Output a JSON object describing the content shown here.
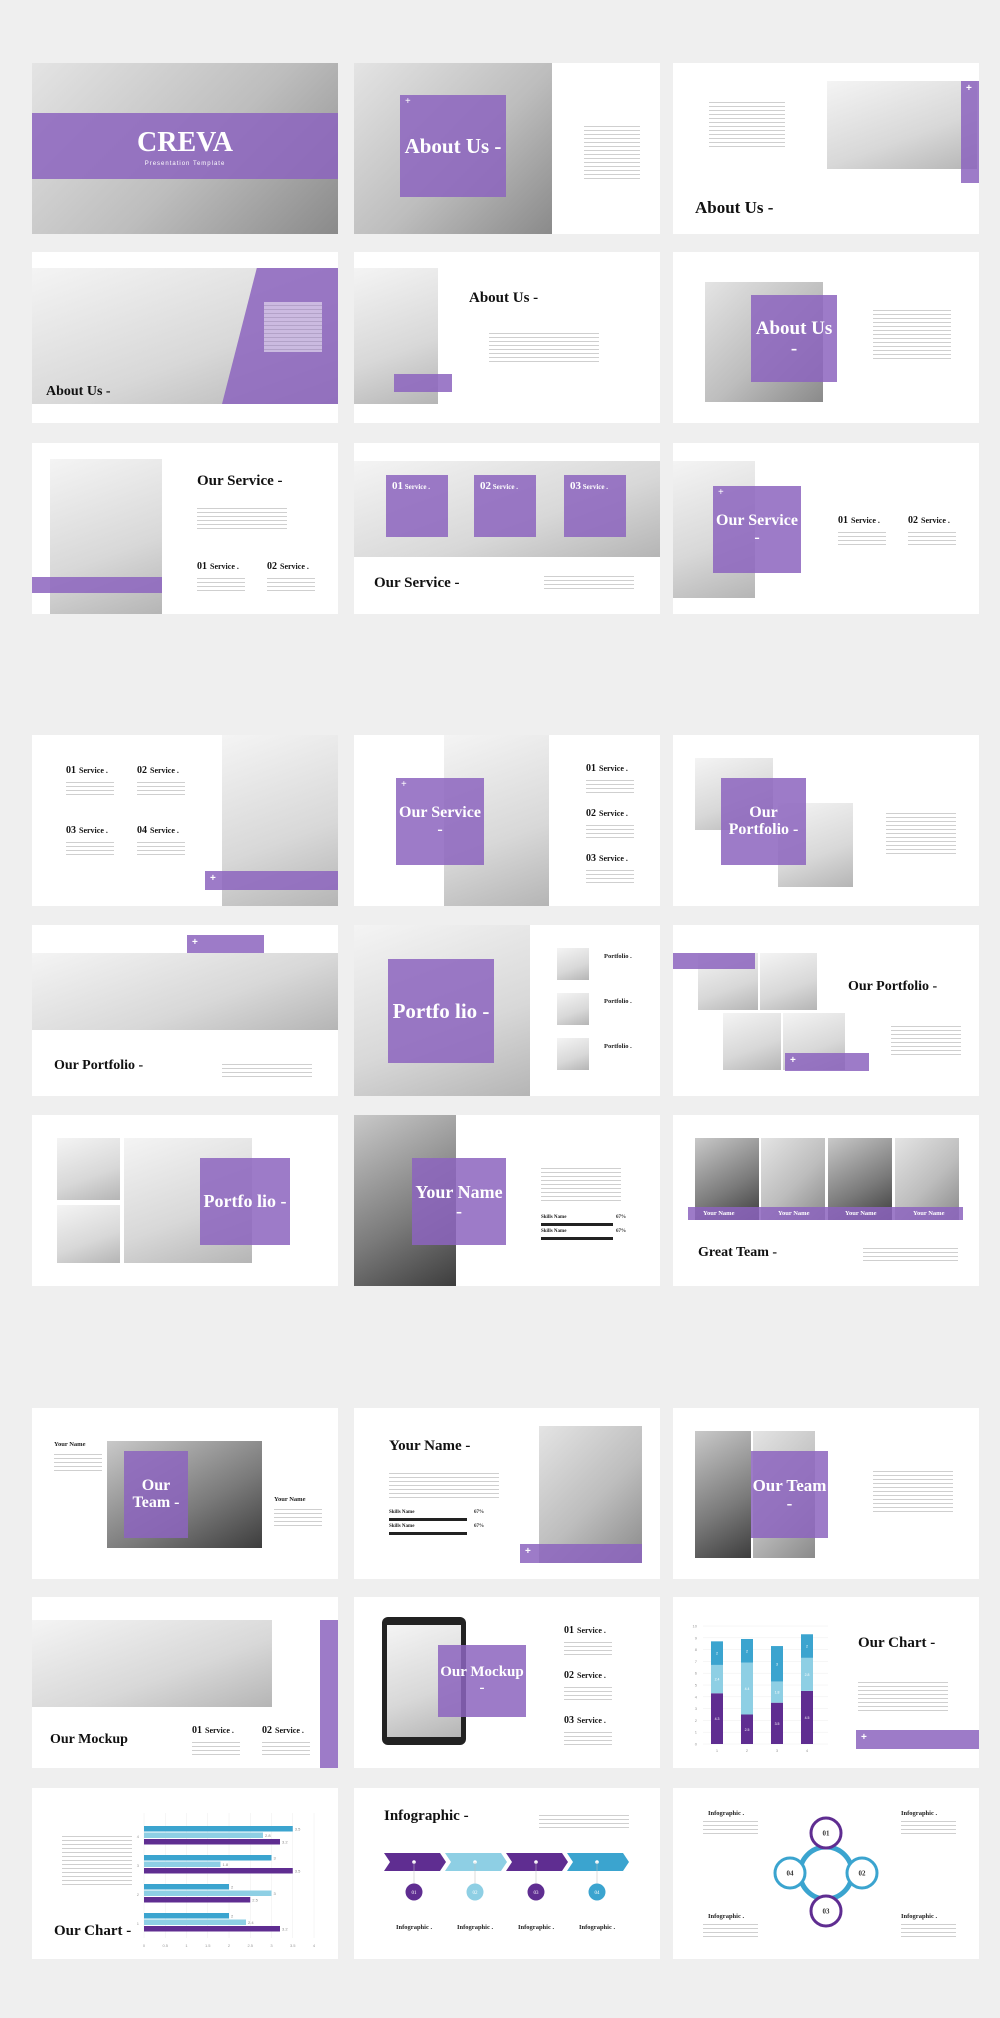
{
  "colors": {
    "background": "#efefef",
    "purple": "#8c64be",
    "dark_purple": "#5f2d91",
    "light_blue": "#8ecfe4",
    "blue": "#3ba4cf"
  },
  "slides": [
    {
      "title": "CREVA",
      "subtitle": "Presentation Template"
    },
    {
      "title": "About Us -"
    },
    {
      "title": "About Us -"
    },
    {
      "title": "About Us -"
    },
    {
      "title": "About Us -"
    },
    {
      "title": "About Us -"
    },
    {
      "title": "Our Service -",
      "items": [
        {
          "num": "01",
          "label": "Service ."
        },
        {
          "num": "02",
          "label": "Service ."
        }
      ]
    },
    {
      "title": "Our Service -",
      "items": [
        {
          "num": "01",
          "label": "Service ."
        },
        {
          "num": "02",
          "label": "Service ."
        },
        {
          "num": "03",
          "label": "Service ."
        }
      ]
    },
    {
      "title": "Our Service -",
      "items": [
        {
          "num": "01",
          "label": "Service ."
        },
        {
          "num": "02",
          "label": "Service ."
        }
      ]
    },
    {
      "items": [
        {
          "num": "01",
          "label": "Service ."
        },
        {
          "num": "02",
          "label": "Service ."
        },
        {
          "num": "03",
          "label": "Service ."
        },
        {
          "num": "04",
          "label": "Service ."
        }
      ]
    },
    {
      "title": "Our Service -",
      "items": [
        {
          "num": "01",
          "label": "Service ."
        },
        {
          "num": "02",
          "label": "Service ."
        },
        {
          "num": "03",
          "label": "Service ."
        }
      ]
    },
    {
      "title": "Our Portfolio -"
    },
    {
      "title": "Our Portfolio -"
    },
    {
      "title": "Portfo lio -",
      "items": [
        {
          "label": "Portfolio ."
        },
        {
          "label": "Portfolio ."
        },
        {
          "label": "Portfolio ."
        }
      ]
    },
    {
      "title": "Our Portfolio -"
    },
    {
      "title": "Portfo lio -"
    },
    {
      "title": "Your Name -",
      "skills": [
        {
          "label": "Skills Name",
          "value": "67%"
        },
        {
          "label": "Skills Name",
          "value": "67%"
        }
      ]
    },
    {
      "title": "Great Team -",
      "names": [
        "Your Name",
        "Your Name",
        "Your Name",
        "Your Name"
      ]
    },
    {
      "title": "Our Team -",
      "names": [
        "Your Name",
        "Your Name"
      ]
    },
    {
      "title": "Your Name -",
      "skills": [
        {
          "label": "Skills Name",
          "value": "67%"
        },
        {
          "label": "Skills Name",
          "value": "67%"
        }
      ]
    },
    {
      "title": "Our Team -"
    },
    {
      "title": "Our Mockup",
      "items": [
        {
          "num": "01",
          "label": "Service ."
        },
        {
          "num": "02",
          "label": "Service ."
        }
      ]
    },
    {
      "title": "Our Mockup -",
      "items": [
        {
          "num": "01",
          "label": "Service ."
        },
        {
          "num": "02",
          "label": "Service ."
        },
        {
          "num": "03",
          "label": "Service ."
        }
      ]
    },
    {
      "title": "Our Chart -"
    },
    {
      "title": "Our Chart -"
    },
    {
      "title": "Infographic -",
      "steps": [
        "01",
        "02",
        "03",
        "04"
      ],
      "labels": [
        "Infographic .",
        "Infographic .",
        "Infographic .",
        "Infographic ."
      ]
    },
    {
      "steps": [
        "01",
        "02",
        "03",
        "04"
      ],
      "labels": [
        "Infographic .",
        "Infographic .",
        "Infographic .",
        "Infographic ."
      ]
    }
  ],
  "chart_data": [
    {
      "type": "bar",
      "stacked": true,
      "categories": [
        "1",
        "2",
        "3",
        "4"
      ],
      "ylim": [
        0,
        10
      ],
      "yticks": [
        "0",
        "1",
        "2",
        "3",
        "4",
        "5",
        "6",
        "7",
        "8",
        "9",
        "10"
      ],
      "series": [
        {
          "color": "#5f2d91",
          "values": [
            4.3,
            2.5,
            3.5,
            4.5
          ]
        },
        {
          "color": "#8ecfe4",
          "values": [
            2.4,
            4.4,
            1.8,
            2.8
          ]
        },
        {
          "color": "#3ba4cf",
          "values": [
            2,
            2,
            3,
            2
          ]
        }
      ]
    },
    {
      "type": "bar",
      "orientation": "horizontal",
      "categories": [
        "1",
        "2",
        "3",
        "4"
      ],
      "xlim": [
        0,
        4
      ],
      "xticks": [
        "0",
        "0.5",
        "1",
        "1.5",
        "2",
        "2.5",
        "3",
        "3.5",
        "4"
      ],
      "series": [
        {
          "color": "#3ba4cf",
          "values": [
            2,
            2,
            3,
            3.5
          ]
        },
        {
          "color": "#8ecfe4",
          "values": [
            2.4,
            3,
            1.8,
            2.8
          ]
        },
        {
          "color": "#5f2d91",
          "values": [
            3.2,
            2.5,
            3.5,
            3.2
          ]
        }
      ]
    }
  ]
}
